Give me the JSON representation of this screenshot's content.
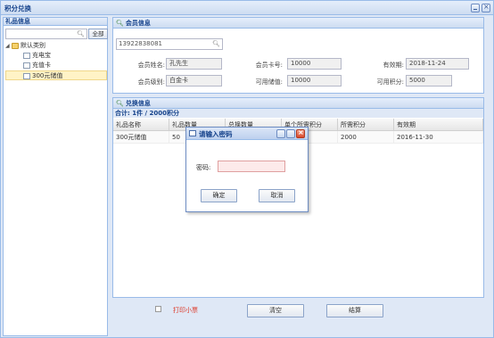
{
  "window": {
    "title": "积分兑换"
  },
  "left_panel": {
    "title": "礼品信息",
    "search_button": "全部",
    "tree": [
      {
        "label": "默认类别",
        "level": 0,
        "type": "folder"
      },
      {
        "label": "充电宝",
        "level": 1,
        "type": "leaf"
      },
      {
        "label": "充值卡",
        "level": 1,
        "type": "leaf"
      },
      {
        "label": "300元储值",
        "level": 1,
        "type": "leaf",
        "selected": true
      }
    ]
  },
  "member": {
    "title": "会员信息",
    "card_search": "13922838081",
    "name_label": "会员姓名:",
    "name_value": "孔先生",
    "card_label": "会员卡号:",
    "card_value": "10000",
    "expire_label": "有效期:",
    "expire_value": "2018-11-24",
    "level_label": "会员级别:",
    "level_value": "白金卡",
    "balance_label": "可用储值:",
    "balance_value": "10000",
    "points_label": "可用积分:",
    "points_value": "5000"
  },
  "exchange": {
    "title": "兑换信息",
    "summary": "合计:  1件    /    2000积分",
    "columns": [
      "礼品名称",
      "礼品数量",
      "总换数量",
      "单个所需积分",
      "所需积分",
      "有效期"
    ],
    "rows": [
      [
        "300元储值",
        "50",
        "",
        "",
        "2000",
        "2016-11-30"
      ]
    ]
  },
  "footer": {
    "print_label": "打印小票",
    "clear_button": "清空",
    "settle_button": "结算"
  },
  "dialog": {
    "title": "请输入密码",
    "password_label": "密码:",
    "ok_button": "确定",
    "cancel_button": "取消"
  }
}
